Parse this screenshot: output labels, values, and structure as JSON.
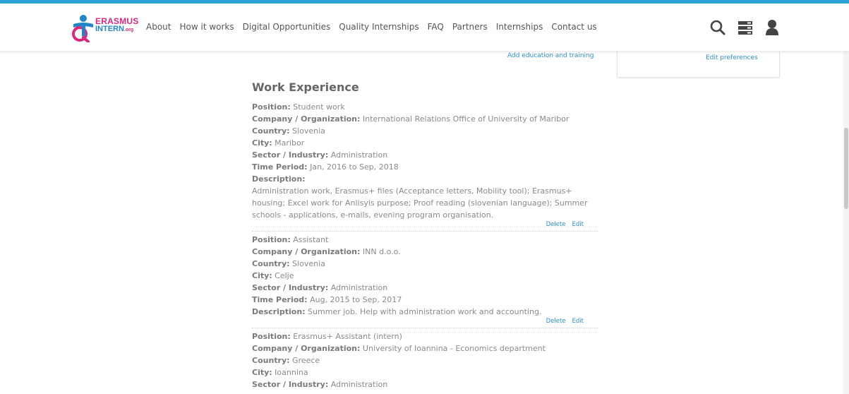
{
  "header": {
    "logo": {
      "line1": "ERASMUS",
      "line2": "INTERN",
      "suffix": ".org"
    },
    "nav": [
      "About",
      "How it works",
      "Digital Opportunities",
      "Quality Internships",
      "FAQ",
      "Partners",
      "Internships",
      "Contact us"
    ],
    "icons": [
      "search-icon",
      "menu-stack-icon",
      "user-icon"
    ]
  },
  "links": {
    "add_education": "Add education and training",
    "edit_preferences": "Edit preferences"
  },
  "work": {
    "title": "Work Experience",
    "labels": {
      "position": "Position:",
      "company": "Company / Organization:",
      "country": "Country:",
      "city": "City:",
      "sector": "Sector / Industry:",
      "period": "Time Period:",
      "description": "Description:"
    },
    "delete_label": "Delete",
    "edit_label": "Edit",
    "entries": [
      {
        "position": "Student work",
        "company": "International Relations Office of University of Maribor",
        "country": "Slovenia",
        "city": "Maribor",
        "sector": "Administration",
        "period": "Jan, 2016 to Sep, 2018",
        "description": "Administration work, Erasmus+ files (Acceptance letters, Mobility tool); Erasmus+ housing; Excel work for Anlisyis purpose; Proof reading (slovenian language); Summer schools - applications, e-mails, evening program organisation."
      },
      {
        "position": "Assistant",
        "company": "INN d.o.o.",
        "country": "Slovenia",
        "city": "Celje",
        "sector": "Administration",
        "period": "Aug, 2015 to Sep, 2017",
        "description": "Summer job. Help with administration work and accounting."
      },
      {
        "position": "Erasmus+ Assistant (intern)",
        "company": "University of Ioannina - Economics department",
        "country": "Greece",
        "city": "Ioannina",
        "sector": "Administration"
      }
    ]
  },
  "colors": {
    "top_bar": "#2aa2d4",
    "link": "#2a8fd0",
    "logo_pink": "#d9287e",
    "logo_blue": "#1f86c8"
  }
}
